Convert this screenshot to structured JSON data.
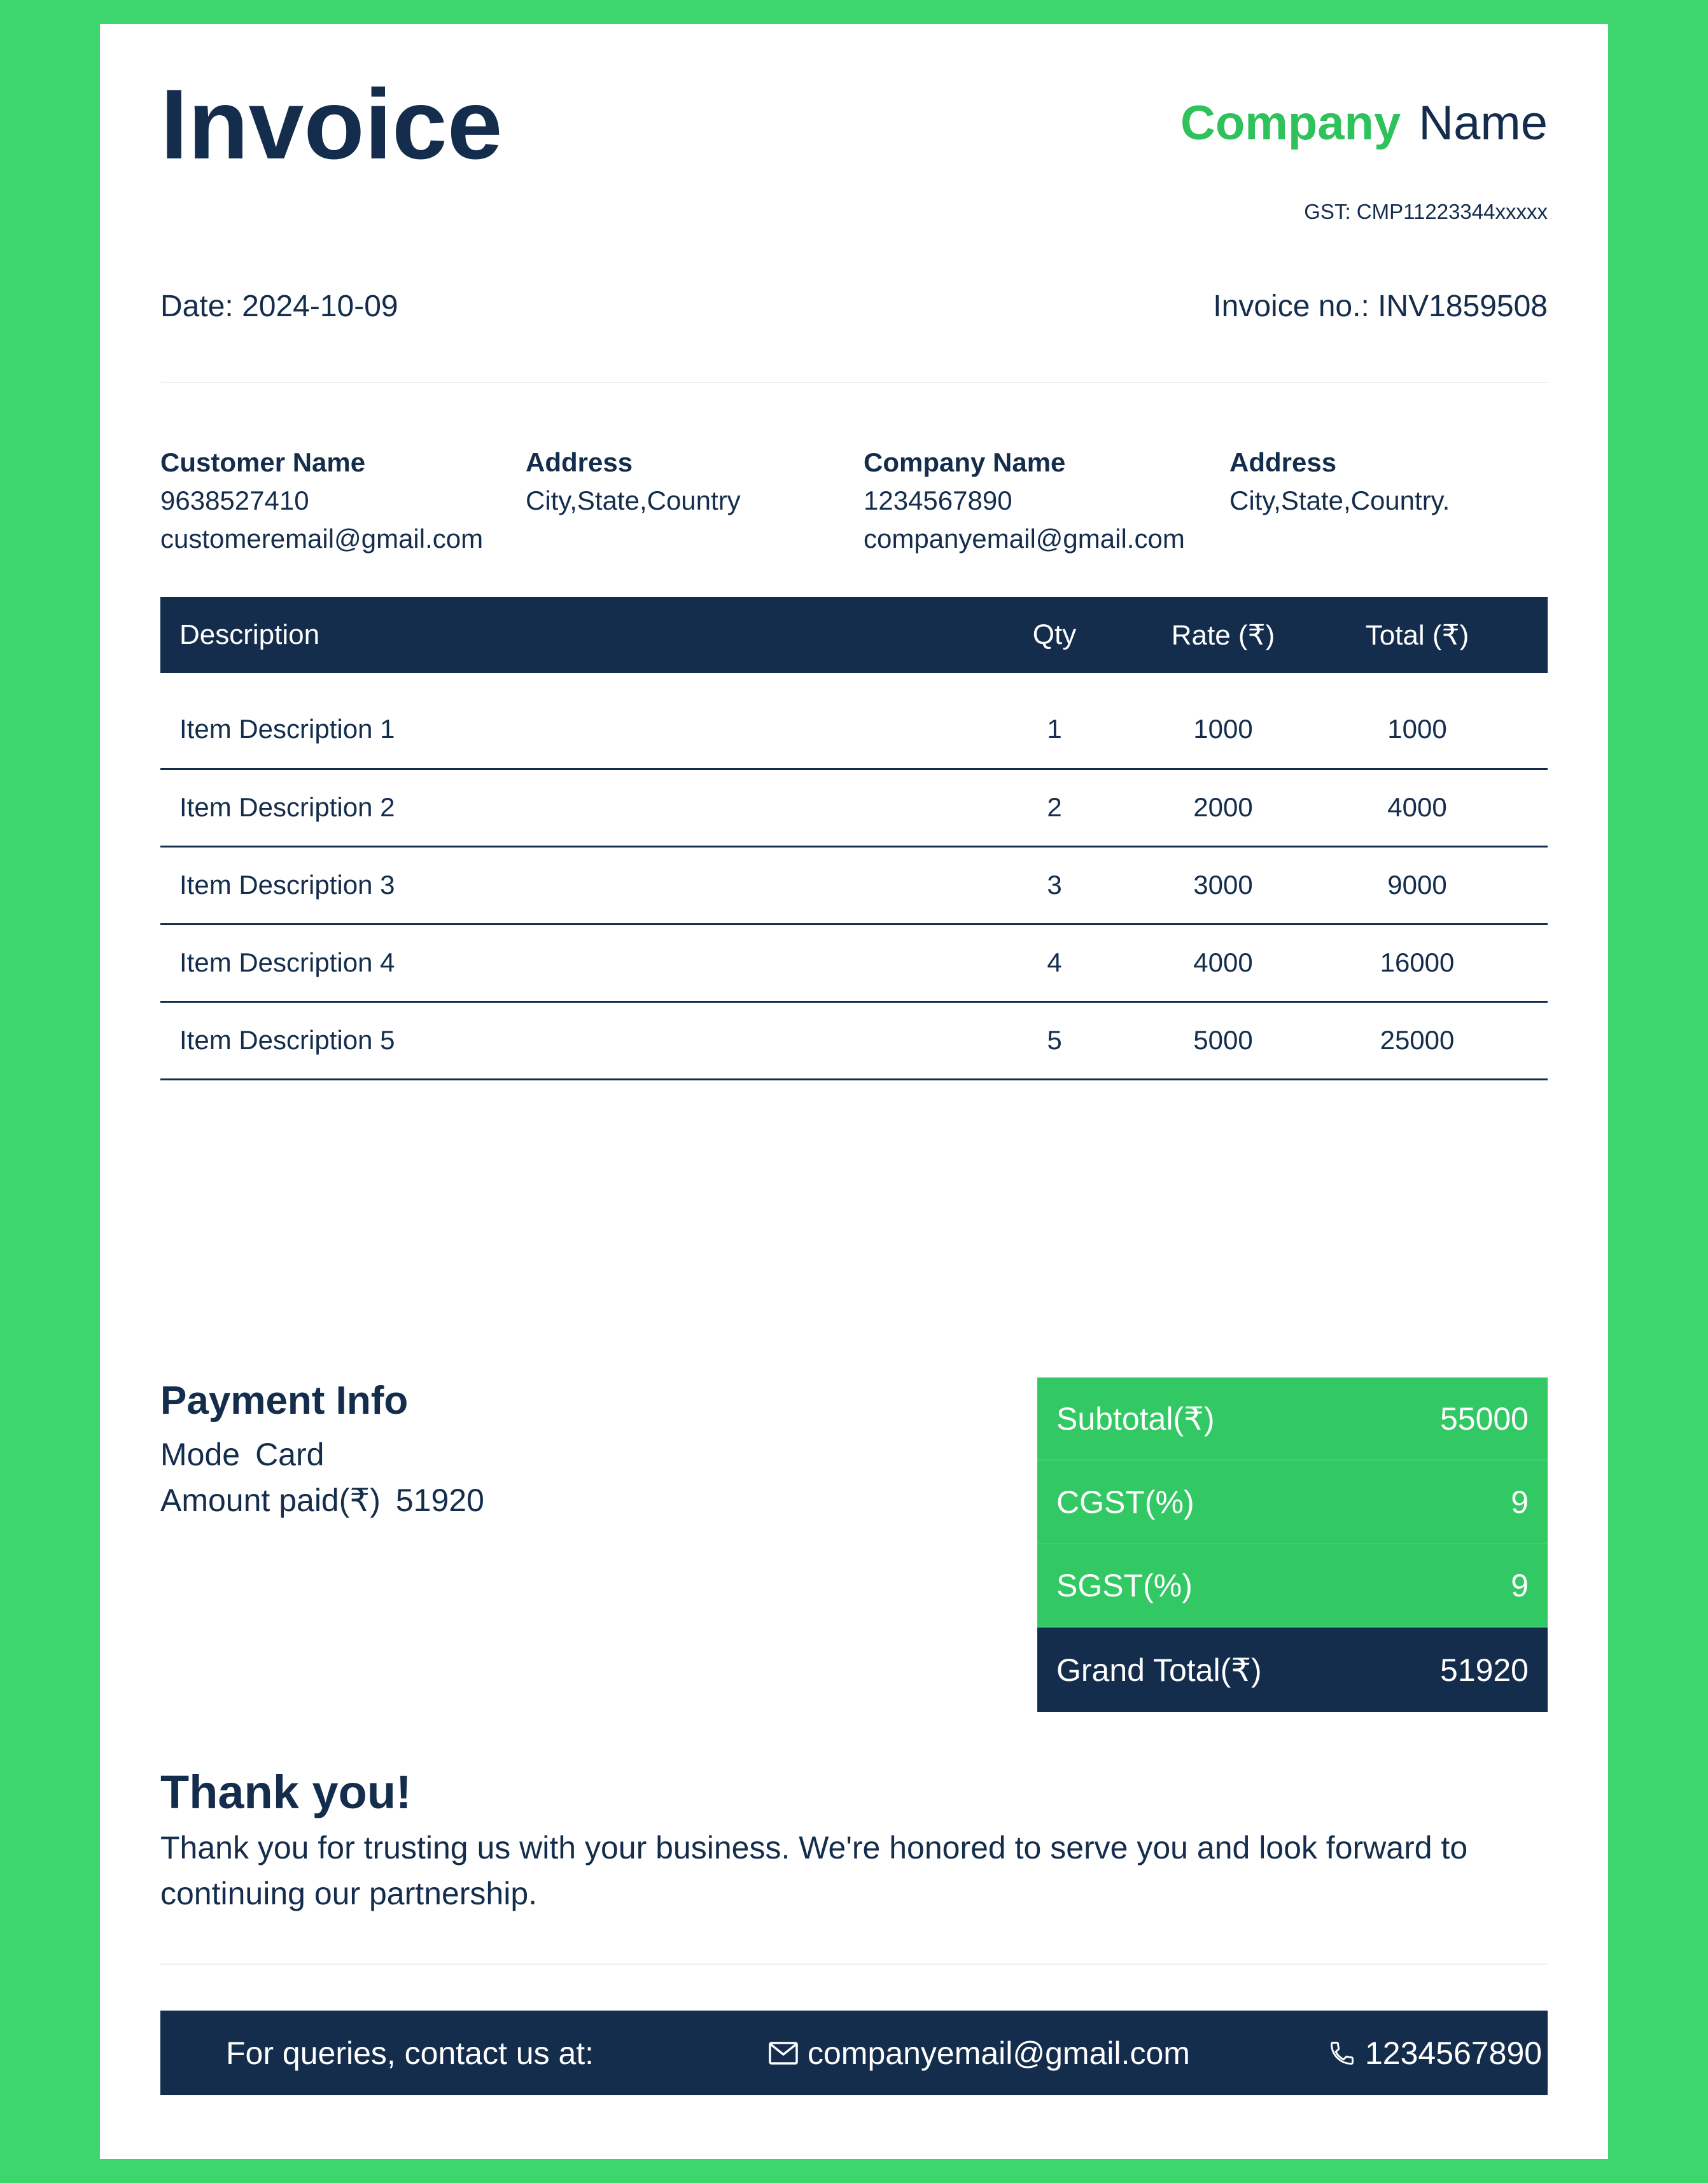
{
  "header": {
    "title": "Invoice",
    "brand_part1": "Company",
    "brand_part2": "Name",
    "gst": "GST: CMP11223344xxxxx",
    "date": "Date: 2024-10-09",
    "invoice_no": "Invoice no.: INV1859508"
  },
  "parties": {
    "customer": {
      "name_label": "Customer Name",
      "phone": "9638527410",
      "email": "customeremail@gmail.com",
      "address_label": "Address",
      "address": "City,State,Country"
    },
    "company": {
      "name_label": "Company Name",
      "phone": "1234567890",
      "email": "companyemail@gmail.com",
      "address_label": "Address",
      "address": "City,State,Country."
    }
  },
  "table": {
    "headers": [
      "Description",
      "Qty",
      "Rate (₹)",
      "Total (₹)"
    ],
    "rows": [
      [
        "Item Description 1",
        "1",
        "1000",
        "1000"
      ],
      [
        "Item Description 2",
        "2",
        "2000",
        "4000"
      ],
      [
        "Item Description 3",
        "3",
        "3000",
        "9000"
      ],
      [
        "Item Description 4",
        "4",
        "4000",
        "16000"
      ],
      [
        "Item Description 5",
        "5",
        "5000",
        "25000"
      ]
    ]
  },
  "payment": {
    "heading": "Payment Info",
    "mode_label": "Mode",
    "mode_value": "Card",
    "amount_label": "Amount paid(₹)",
    "amount_value": "51920"
  },
  "totals": {
    "subtotal_label": "Subtotal(₹)",
    "subtotal_value": "55000",
    "cgst_label": "CGST(%)",
    "cgst_value": "9",
    "sgst_label": "SGST(%)",
    "sgst_value": "9",
    "grand_label": "Grand Total(₹)",
    "grand_value": "51920"
  },
  "thanks": {
    "heading": "Thank you!",
    "text": "Thank you for trusting us with your business. We're honored to serve you and look forward to continuing our partnership."
  },
  "footer": {
    "label": "For queries, contact us at:",
    "email": "companyemail@gmail.com",
    "phone": "1234567890",
    "icons": [
      "mail-icon",
      "phone-icon"
    ]
  },
  "colors": {
    "background": "#3dd56d",
    "navy": "#142d4c",
    "green_accent": "#2fc25c",
    "totals_green": "#32c863"
  }
}
